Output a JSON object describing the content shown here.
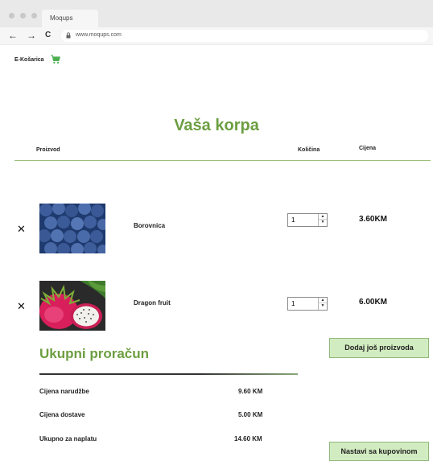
{
  "browser": {
    "tab_title": "Moqups",
    "url": "www.moqups.com",
    "back": "←",
    "forward": "→",
    "reload": "C"
  },
  "header": {
    "brand": "E-Košarica"
  },
  "page": {
    "title": "Vaša korpa"
  },
  "table": {
    "headers": {
      "product": "Proizvod",
      "quantity": "Količina",
      "price": "Cijena"
    },
    "rows": [
      {
        "remove": "✕",
        "name": "Borovnica",
        "quantity": "1",
        "price": "3.60KM"
      },
      {
        "remove": "✕",
        "name": "Dragon fruit",
        "quantity": "1",
        "price": "6.00KM"
      }
    ]
  },
  "actions": {
    "add_more": "Dodaj još proizvoda",
    "continue": "Nastavi sa kupovinom"
  },
  "summary": {
    "title": "Ukupni proračun",
    "rows": [
      {
        "label": "Cijena narudžbe",
        "value": "9.60 KM"
      },
      {
        "label": "Cijena dostave",
        "value": "5.00 KM"
      },
      {
        "label": "Ukupno za naplatu",
        "value": "14.60 KM"
      }
    ]
  },
  "colors": {
    "accent_green": "#6c9e41",
    "button_bg": "#d2ecc1",
    "button_border": "#8fb87a"
  },
  "icons": {
    "cart": "shopping-cart-icon",
    "remove": "close-icon",
    "lock": "lock-icon"
  }
}
